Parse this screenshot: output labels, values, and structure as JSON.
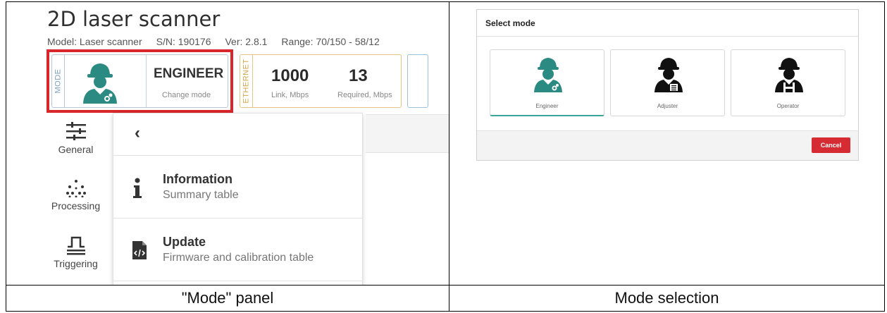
{
  "left_panel": {
    "app_title": "2D laser scanner",
    "meta": {
      "model": "Model: Laser scanner",
      "serial": "S/N: 190176",
      "version": "Ver: 2.8.1",
      "range": "Range: 70/150 - 58/12"
    },
    "mode_card": {
      "tag": "MODE",
      "name": "ENGINEER",
      "subtitle": "Change mode",
      "icon": "engineer-icon",
      "icon_color": "#2b8a82"
    },
    "ethernet_card": {
      "tag": "ETHERNET",
      "link_value": "1000",
      "link_label": "Link, Mbps",
      "required_value": "13",
      "required_label": "Required, Mbps"
    },
    "sidebar": [
      {
        "label": "General",
        "icon": "sliders-icon"
      },
      {
        "label": "Processing",
        "icon": "dots-icon"
      },
      {
        "label": "Triggering",
        "icon": "pulse-icon"
      }
    ],
    "menu": {
      "back_icon": "chevron-left-icon",
      "items": [
        {
          "title": "Information",
          "description": "Summary table",
          "icon": "info-icon"
        },
        {
          "title": "Update",
          "description": "Firmware and calibration table",
          "icon": "code-file-icon"
        }
      ]
    }
  },
  "right_panel": {
    "dialog_title": "Select mode",
    "modes": [
      {
        "label": "Engineer",
        "icon": "engineer-icon",
        "color": "#2b8a82",
        "selected": true
      },
      {
        "label": "Adjuster",
        "icon": "adjuster-icon",
        "color": "#111111",
        "selected": false
      },
      {
        "label": "Operator",
        "icon": "operator-icon",
        "color": "#111111",
        "selected": false
      }
    ],
    "cancel_label": "Cancel",
    "cancel_color": "#d62b32"
  },
  "captions": {
    "left": "\"Mode\" panel",
    "right": "Mode selection"
  }
}
